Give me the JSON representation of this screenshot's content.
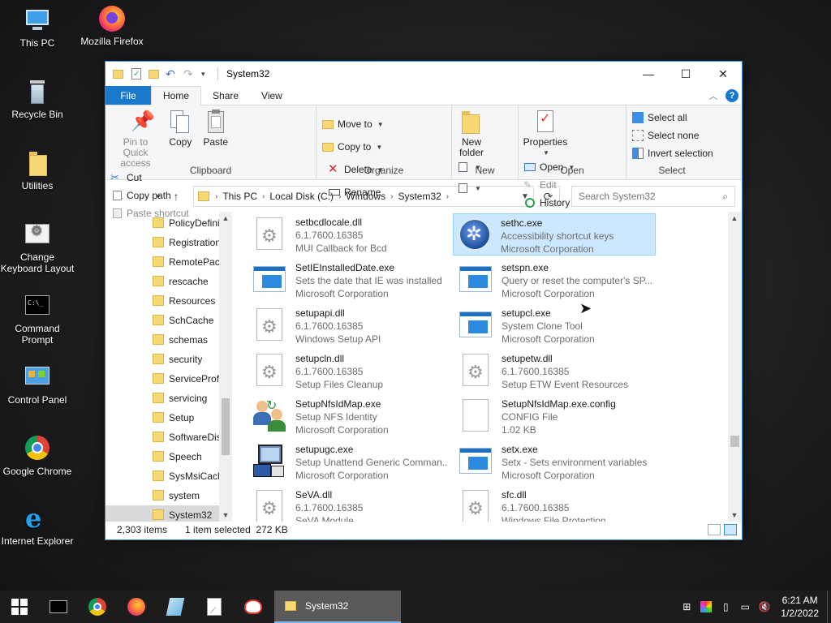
{
  "desktop": {
    "icons": [
      {
        "label": "This PC"
      },
      {
        "label": "Mozilla Firefox"
      },
      {
        "label": "Recycle Bin"
      },
      {
        "label": "Utilities"
      },
      {
        "label": "Change Keyboard Layout"
      },
      {
        "label": "Command Prompt"
      },
      {
        "label": "Control Panel"
      },
      {
        "label": "Google Chrome"
      },
      {
        "label": "Internet Explorer"
      }
    ]
  },
  "window": {
    "title": "System32",
    "controls": {
      "minimize": "—",
      "maximize": "☐",
      "close": "✕"
    },
    "tabs": {
      "file": "File",
      "home": "Home",
      "share": "Share",
      "view": "View"
    },
    "ribbon": {
      "clipboard": {
        "label": "Clipboard",
        "pin": "Pin to Quick access",
        "copy": "Copy",
        "paste": "Paste",
        "cut": "Cut",
        "copy_path": "Copy path",
        "paste_shortcut": "Paste shortcut"
      },
      "organize": {
        "label": "Organize",
        "move_to": "Move to",
        "copy_to": "Copy to",
        "delete": "Delete",
        "rename": "Rename"
      },
      "new": {
        "label": "New",
        "new_folder": "New folder"
      },
      "open": {
        "label": "Open",
        "properties": "Properties",
        "open": "Open",
        "edit": "Edit",
        "history": "History"
      },
      "select": {
        "label": "Select",
        "select_all": "Select all",
        "select_none": "Select none",
        "invert": "Invert selection"
      }
    },
    "address": {
      "crumbs": [
        "This PC",
        "Local Disk (C:)",
        "Windows",
        "System32"
      ]
    },
    "search": {
      "placeholder": "Search System32"
    },
    "nav_items": [
      "PolicyDefini",
      "Registration",
      "RemotePack",
      "rescache",
      "Resources",
      "SchCache",
      "schemas",
      "security",
      "ServiceProfi",
      "servicing",
      "Setup",
      "SoftwareDis",
      "Speech",
      "SysMsiCach",
      "system",
      "System32"
    ],
    "files": [
      {
        "name": "setbcdlocale.dll",
        "line2": "6.1.7600.16385",
        "line3": "MUI Callback for Bcd",
        "icon": "gear-doc-icon"
      },
      {
        "name": "sethc.exe",
        "line2": "Accessibility shortcut keys",
        "line3": "Microsoft Corporation",
        "icon": "accessibility-icon",
        "selected": true
      },
      {
        "name": "SetIEInstalledDate.exe",
        "line2": "Sets the date that IE was installed",
        "line3": "Microsoft Corporation",
        "icon": "window-exe-icon"
      },
      {
        "name": "setspn.exe",
        "line2": "Query or reset the computer's SP...",
        "line3": "Microsoft Corporation",
        "icon": "window-exe-icon"
      },
      {
        "name": "setupapi.dll",
        "line2": "6.1.7600.16385",
        "line3": "Windows Setup API",
        "icon": "gear-doc-icon"
      },
      {
        "name": "setupcl.exe",
        "line2": "System Clone Tool",
        "line3": "Microsoft Corporation",
        "icon": "window-exe-icon"
      },
      {
        "name": "setupcln.dll",
        "line2": "6.1.7600.16385",
        "line3": "Setup Files Cleanup",
        "icon": "gear-doc-icon"
      },
      {
        "name": "setupetw.dll",
        "line2": "6.1.7600.16385",
        "line3": "Setup ETW Event Resources",
        "icon": "gear-doc-icon"
      },
      {
        "name": "SetupNfsIdMap.exe",
        "line2": "Setup NFS Identity",
        "line3": "Microsoft Corporation",
        "icon": "users-icon"
      },
      {
        "name": "SetupNfsIdMap.exe.config",
        "line2": "CONFIG File",
        "line3": "1.02 KB",
        "icon": "blank-doc-icon"
      },
      {
        "name": "setupugc.exe",
        "line2": "Setup Unattend Generic Comman...",
        "line3": "Microsoft Corporation",
        "icon": "computer-setup-icon"
      },
      {
        "name": "setx.exe",
        "line2": "Setx - Sets environment variables",
        "line3": "Microsoft Corporation",
        "icon": "window-exe-icon"
      },
      {
        "name": "SeVA.dll",
        "line2": "6.1.7600.16385",
        "line3": "SeVA Module",
        "icon": "gear-doc-icon"
      },
      {
        "name": "sfc.dll",
        "line2": "6.1.7600.16385",
        "line3": "Windows File Protection",
        "icon": "gear-doc-icon"
      }
    ],
    "status": {
      "items": "2,303 items",
      "selected": "1 item selected  272 KB"
    }
  },
  "taskbar": {
    "active_app": "System32",
    "clock_time": "6:21 AM",
    "clock_date": "1/2/2022"
  }
}
